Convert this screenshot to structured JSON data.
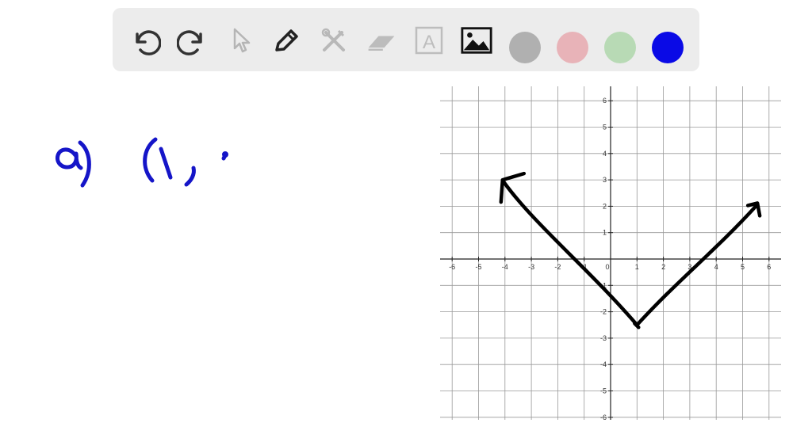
{
  "toolbar": {
    "tools": [
      {
        "name": "undo-icon",
        "state": "enabled"
      },
      {
        "name": "redo-icon",
        "state": "enabled"
      },
      {
        "name": "select-cursor-icon",
        "state": "disabled"
      },
      {
        "name": "pen-icon",
        "state": "active"
      },
      {
        "name": "tools-icon",
        "state": "disabled"
      },
      {
        "name": "eraser-icon",
        "state": "disabled"
      },
      {
        "name": "text-icon",
        "state": "disabled",
        "glyph": "A"
      },
      {
        "name": "image-icon",
        "state": "enabled"
      }
    ],
    "colors": [
      {
        "name": "gray",
        "hex": "#b0b0b0"
      },
      {
        "name": "pink",
        "hex": "#e8b3b8"
      },
      {
        "name": "green",
        "hex": "#b8dab5"
      },
      {
        "name": "blue",
        "hex": "#0a0ae6",
        "selected": true
      }
    ]
  },
  "handwriting": {
    "part_label": "a)",
    "expression": "(1,",
    "ink_color": "#1515c8"
  },
  "graph": {
    "x_range": [
      -6,
      6
    ],
    "y_range": [
      -6,
      6
    ],
    "x_tick_labels": [
      "-6",
      "-5",
      "-4",
      "-3",
      "-2",
      "-1",
      "0",
      "1",
      "2",
      "3",
      "4",
      "5",
      "6"
    ],
    "y_tick_labels": [
      "6",
      "5",
      "4",
      "3",
      "2",
      "1",
      "-1",
      "-2",
      "-3",
      "-4",
      "-5",
      "-6"
    ],
    "vertex": [
      1,
      -2.5
    ],
    "left_arrow_end": [
      -4,
      3
    ],
    "right_arrow_end": [
      5.5,
      2
    ],
    "ink_color": "#000000"
  }
}
